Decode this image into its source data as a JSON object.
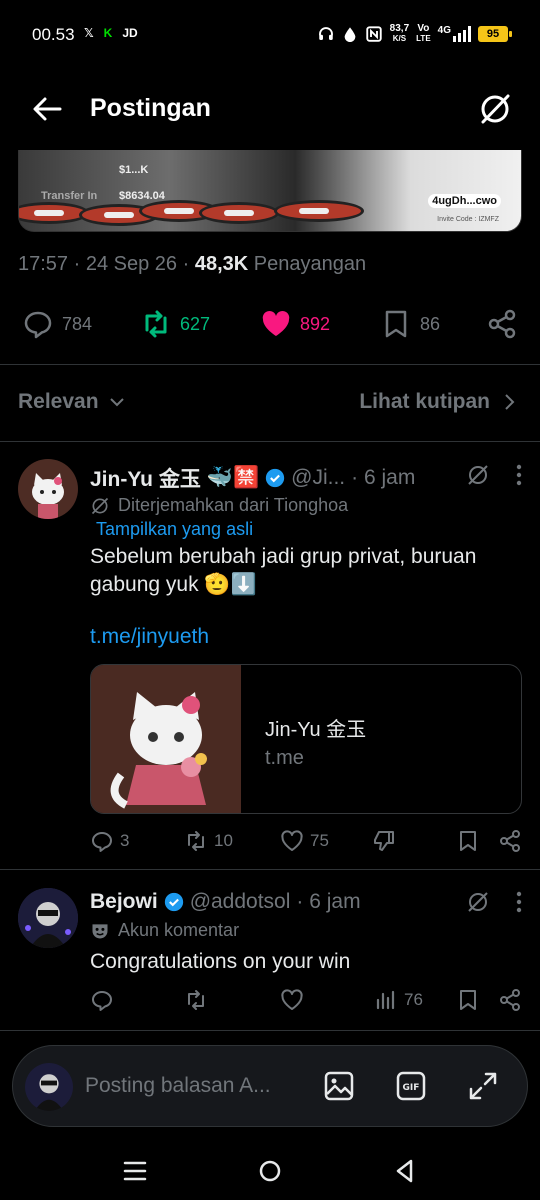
{
  "status_bar": {
    "time": "00.53",
    "apps": [
      "𝕏",
      "K",
      "JD"
    ],
    "speed": "83,7",
    "speed_unit": "K/S",
    "volte": "Vo",
    "lte": "LTE",
    "network": "4G",
    "battery": "95"
  },
  "header": {
    "title": "Postingan"
  },
  "media": {
    "labels": [
      "$1...K",
      "$8634.04",
      "Transfer In"
    ],
    "invite_handle": "4ugDh...cwo",
    "invite_code": "Invite Code : IZMFZ"
  },
  "post_meta": {
    "time": "17:57",
    "date": "24 Sep 26",
    "views_count": "48,3K",
    "views_label": "Penayangan"
  },
  "engagement": {
    "replies": "784",
    "reposts": "627",
    "likes": "892",
    "bookmarks": "86"
  },
  "filter": {
    "sort_label": "Relevan",
    "quotes_label": "Lihat kutipan"
  },
  "replies": [
    {
      "name": "Jin-Yu 金玉",
      "emojis": "🐳🈲",
      "handle": "@Ji...",
      "time": "· 6 jam",
      "translated_note": "Diterjemahkan dari Tionghoa",
      "show_original": "Tampilkan yang asli",
      "text": "Sebelum berubah jadi grup privat, buruan gabung yuk 🫡⬇️",
      "link": "t.me/jinyueth",
      "card": {
        "title": "Jin-Yu 金玉",
        "domain": "t.me"
      },
      "actions": {
        "replies": "3",
        "reposts": "10",
        "likes": "75"
      }
    },
    {
      "name": "Bejowi",
      "handle": "@addotsol",
      "time": "· 6 jam",
      "note": "Akun komentar",
      "text": "Congratulations on your win",
      "actions": {
        "views": "76"
      }
    }
  ],
  "composer": {
    "placeholder": "Posting balasan A..."
  },
  "colors": {
    "like": "#f91880",
    "repost": "#00ba7c",
    "link": "#1d9bf0",
    "muted": "#71767b",
    "verified": "#1d9bf0"
  }
}
